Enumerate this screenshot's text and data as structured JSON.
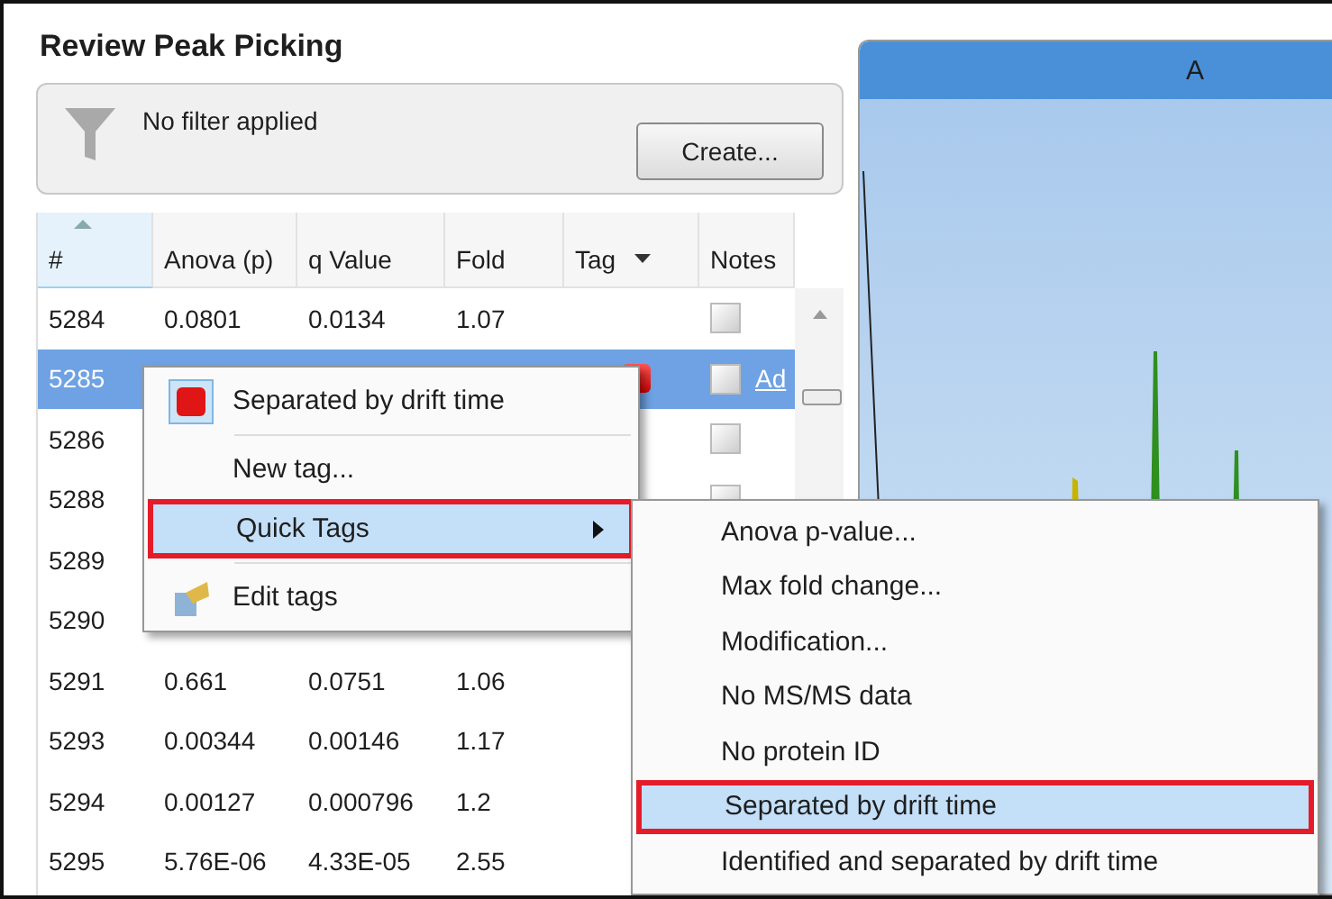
{
  "panel": {
    "title": "Review Peak Picking"
  },
  "filter": {
    "text": "No filter applied",
    "button": "Create..."
  },
  "table": {
    "columns": [
      {
        "label": "#",
        "sorted": true
      },
      {
        "label": "Anova (p)",
        "sorted": false
      },
      {
        "label": "q Value",
        "sorted": false
      },
      {
        "label": "Fold",
        "sorted": false
      },
      {
        "label": "Tag",
        "sorted": false,
        "dropdown": true
      },
      {
        "label": "Notes",
        "sorted": false
      }
    ],
    "rows": [
      {
        "cells": [
          "5284",
          "0.0801",
          "0.0134",
          "1.07"
        ],
        "selected": false,
        "tag": false,
        "note": true
      },
      {
        "cells": [
          "5285"
        ],
        "selected": true,
        "tag": true,
        "note": true,
        "link": "Ad"
      },
      {
        "cells": [
          "5286"
        ],
        "selected": false,
        "tag": false,
        "note": true
      },
      {
        "cells": [
          "5288"
        ],
        "selected": false,
        "tag": false,
        "note": true
      },
      {
        "cells": [
          "5289"
        ],
        "selected": false
      },
      {
        "cells": [
          "5290"
        ],
        "selected": false
      },
      {
        "cells": [
          "5291",
          "0.661",
          "0.0751",
          "1.06"
        ],
        "selected": false
      },
      {
        "cells": [
          "5293",
          "0.00344",
          "0.00146",
          "1.17"
        ],
        "selected": false
      },
      {
        "cells": [
          "5294",
          "0.00127",
          "0.000796",
          "1.2"
        ],
        "selected": false
      },
      {
        "cells": [
          "5295",
          "5.76E-06",
          "4.33E-05",
          "2.55"
        ],
        "selected": false
      }
    ]
  },
  "context_menu": {
    "items": [
      {
        "kind": "tag",
        "label": "Separated by drift time",
        "selected": false,
        "outlined": false
      },
      {
        "kind": "separator"
      },
      {
        "kind": "item",
        "label": "New tag...",
        "selected": false,
        "outlined": false
      },
      {
        "kind": "submenu",
        "label": "Quick Tags",
        "selected": true,
        "outlined": true
      },
      {
        "kind": "separator"
      },
      {
        "kind": "edit",
        "label": "Edit tags",
        "selected": false,
        "outlined": false
      }
    ]
  },
  "submenu": {
    "items": [
      {
        "label": "Anova p-value...",
        "selected": false,
        "outlined": false
      },
      {
        "label": "Max fold change...",
        "selected": false,
        "outlined": false
      },
      {
        "label": "Modification...",
        "selected": false,
        "outlined": false
      },
      {
        "label": "No MS/MS data",
        "selected": false,
        "outlined": false
      },
      {
        "label": "No protein ID",
        "selected": false,
        "outlined": false
      },
      {
        "label": "Separated by drift time",
        "selected": true,
        "outlined": true
      },
      {
        "label": "Identified and separated by drift time",
        "selected": false,
        "outlined": false
      }
    ]
  },
  "chart_panel": {
    "title": "A"
  }
}
